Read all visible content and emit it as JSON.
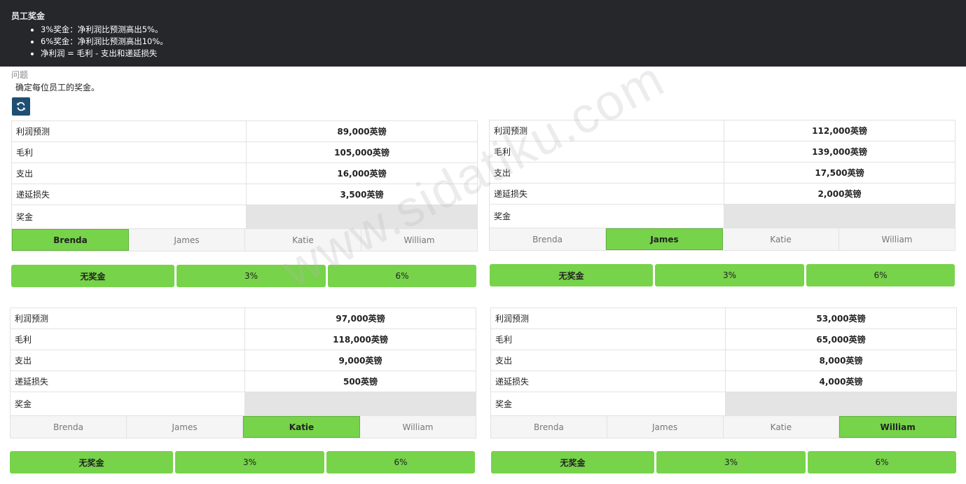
{
  "header": {
    "title": "员工奖金",
    "rules": [
      "3%奖金：净利润比预测高出5%。",
      "6%奖金：净利润比预测高出10%。",
      "净利润 = 毛利 - 支出和递延损失"
    ]
  },
  "question": {
    "title": "问题",
    "text": "确定每位员工的奖金。"
  },
  "labels": {
    "forecast": "利润预测",
    "gross": "毛利",
    "expenses": "支出",
    "deferred": "递延损失",
    "bonus": "奖金"
  },
  "cards": [
    {
      "forecast": "89,000英镑",
      "gross": "105,000英镑",
      "expenses": "16,000英镑",
      "deferred": "3,500英镑",
      "bonus": "",
      "active": "Brenda"
    },
    {
      "forecast": "112,000英镑",
      "gross": "139,000英镑",
      "expenses": "17,500英镑",
      "deferred": "2,000英镑",
      "bonus": "",
      "active": "James"
    },
    {
      "forecast": "97,000英镑",
      "gross": "118,000英镑",
      "expenses": "9,000英镑",
      "deferred": "500英镑",
      "bonus": "",
      "active": "Katie"
    },
    {
      "forecast": "53,000英镑",
      "gross": "65,000英镑",
      "expenses": "8,000英镑",
      "deferred": "4,000英镑",
      "bonus": "",
      "active": "William"
    }
  ],
  "employees": [
    "Brenda",
    "James",
    "Katie",
    "William"
  ],
  "options": [
    "无奖金",
    "3%",
    "6%"
  ],
  "watermark": "www.sidatiku.com",
  "colors": {
    "header_bg": "#25272b",
    "accent_green": "#77d34a",
    "refresh_button": "#1d4f72",
    "bonus_cell": "#e4e4e4"
  },
  "icons": {
    "refresh": "refresh-icon"
  }
}
